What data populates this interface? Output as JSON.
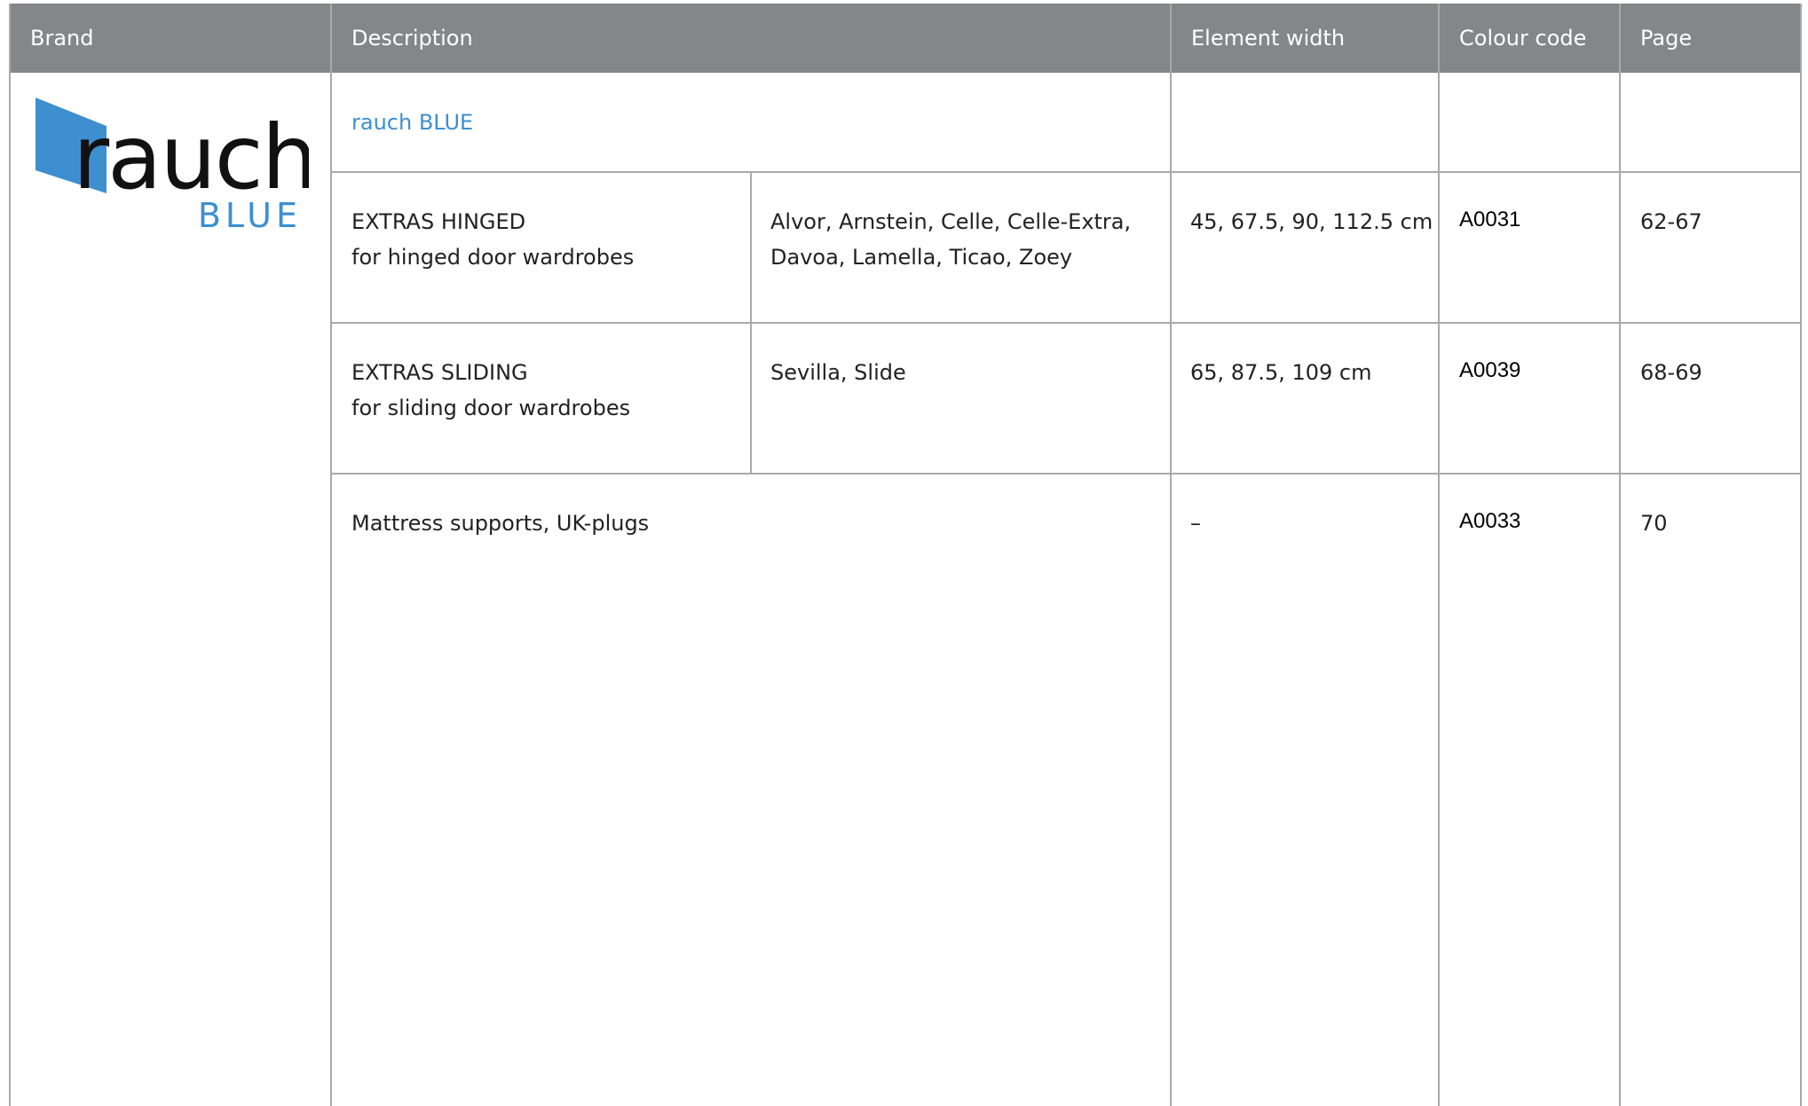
{
  "header": {
    "brand": "Brand",
    "description": "Description",
    "element_width": "Element width",
    "colour_code": "Colour code",
    "page": "Page"
  },
  "brand_logo": {
    "word": "rauch",
    "sub": "BLUE",
    "accent_color": "#3d8fd0"
  },
  "rows": [
    {
      "description": "rauch BLUE"
    },
    {
      "title": "EXTRAS HINGED",
      "subtitle": "for hinged door wardrobes",
      "models_line1": "Alvor,  Arnstein,  Celle,  Celle-Extra,",
      "models_line2": "Davoa, Lamella, Ticao, Zoey",
      "width": "45, 67.5, 90, 112.5 cm",
      "code": "A0031",
      "page": "62-67"
    },
    {
      "title": "EXTRAS SLIDING",
      "subtitle": "for sliding door wardrobes",
      "models_line1": "Sevilla, Slide",
      "width": "65, 87.5, 109 cm",
      "code": "A0039",
      "page": "68-69"
    },
    {
      "description": "Mattress supports, UK-plugs",
      "width": "–",
      "code": "A0033",
      "page": "70"
    }
  ]
}
